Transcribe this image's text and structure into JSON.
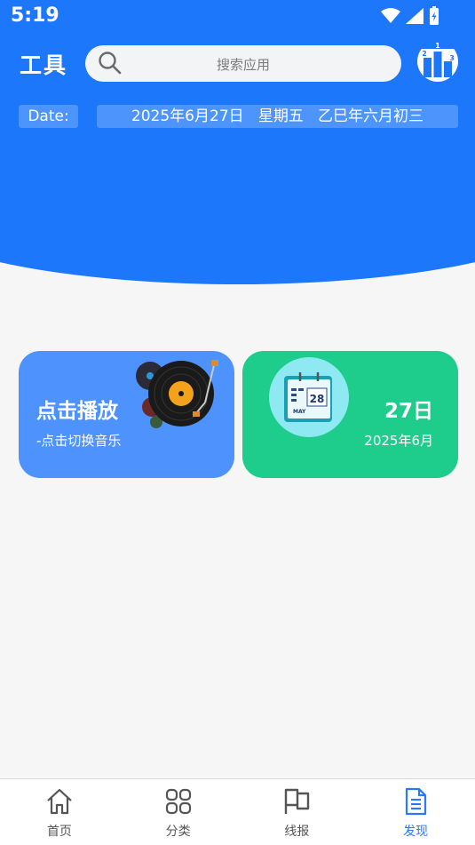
{
  "status_bar": {
    "time": "5:19"
  },
  "header": {
    "title": "工具",
    "search_placeholder": "搜索应用",
    "rank_icon": "podium-icon"
  },
  "date_row": {
    "label": "Date:",
    "value": "2025年6月27日   星期五   乙巳年六月初三"
  },
  "cards": {
    "music": {
      "title": "点击播放",
      "subtitle": "-点击切换音乐",
      "icon": "vinyl-record-icon"
    },
    "calendar": {
      "day": "27日",
      "month": "2025年6月",
      "icon": "calendar-icon"
    }
  },
  "bottom_nav": {
    "items": [
      {
        "label": "首页",
        "icon": "home-icon",
        "active": false
      },
      {
        "label": "分类",
        "icon": "grid-icon",
        "active": false
      },
      {
        "label": "线报",
        "icon": "flag-icon",
        "active": false
      },
      {
        "label": "发现",
        "icon": "document-icon",
        "active": true
      }
    ]
  },
  "colors": {
    "primary_blue": "#1c77fb",
    "music_card": "#4e92fd",
    "calendar_card": "#1ecc8b",
    "nav_active": "#2a78ff"
  }
}
